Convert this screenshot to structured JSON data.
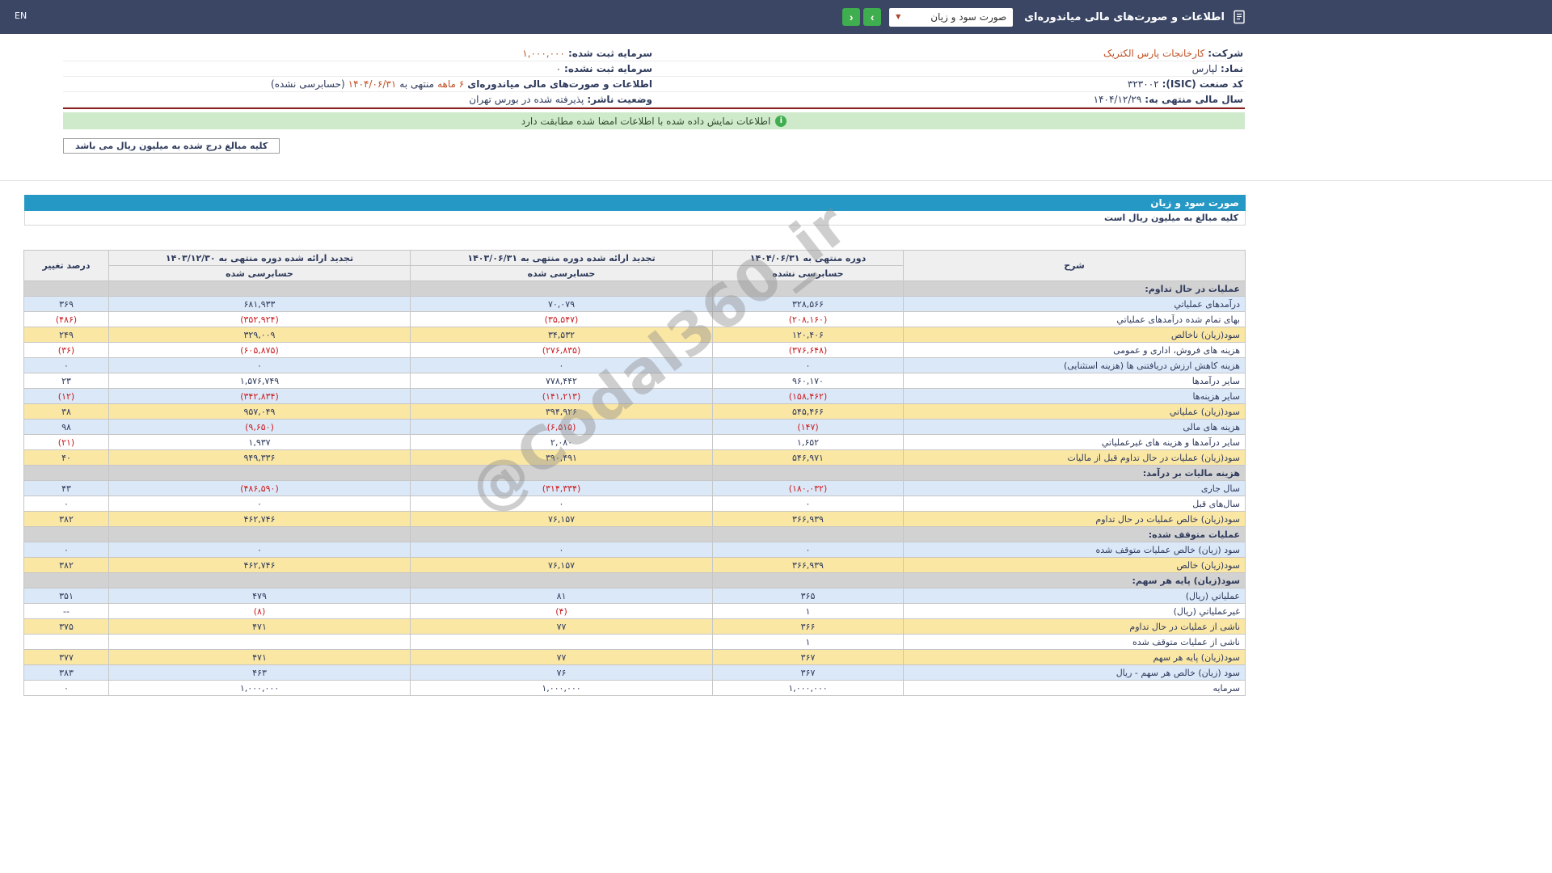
{
  "topbar": {
    "en_label": "EN",
    "title": "اطلاعات و صورت‌های مالی میاندوره‌ای",
    "report_select": {
      "value": "صورت سود و زیان",
      "caret": "▼"
    },
    "nav": {
      "forward": "›",
      "back": "‹"
    }
  },
  "company": {
    "fields": [
      {
        "label": "شرکت:",
        "value": "کارخانجات پارس الکتریک",
        "value_style": "accent"
      },
      {
        "label": "سرمایه ثبت شده:",
        "value": "۱,۰۰۰,۰۰۰",
        "value_style": "accent"
      },
      {
        "label": "نماد:",
        "value": "لپارس"
      },
      {
        "label": "سرمایه ثبت نشده:",
        "value": "۰"
      },
      {
        "label": "کد صنعت (ISIC):",
        "value": "۳۲۳۰۰۲"
      },
      {
        "label": "اطلاعات و صورت‌های مالی میاندوره‌ای",
        "value_parts": [
          {
            "text": "۶ ماهه",
            "accent": true
          },
          {
            "text": " منتهی به ",
            "accent": false
          },
          {
            "text": "۱۴۰۴/۰۶/۳۱",
            "accent": true
          },
          {
            "text": "(حسابرسی نشده)",
            "accent": false
          }
        ]
      },
      {
        "label": "سال مالی منتهی به:",
        "value": "۱۴۰۴/۱۲/۲۹"
      },
      {
        "label": "وضعیت ناشر:",
        "value": "پذیرفته شده در بورس تهران"
      }
    ],
    "signature_notice": "اطلاعات نمایش داده شده با اطلاعات امضا شده مطابقت دارد",
    "info_icon_glyph": "i",
    "unit_note": "کلیه مبالغ درج شده به میلیون ریال می باشد"
  },
  "statement": {
    "title": "صورت سود و زیان",
    "unit_note": "کلیه مبالغ به میلیون ریال است",
    "table": {
      "desc_header": "شرح",
      "pct_header": "درصد تغییر",
      "period_headers": [
        {
          "title": "دوره منتهی به ۱۴۰۴/۰۶/۳۱",
          "sub": "حسابرسی نشده"
        },
        {
          "title": "تجدید ارائه شده دوره منتهی به ۱۴۰۳/۰۶/۳۱",
          "sub": "حسابرسی شده"
        },
        {
          "title": "تجدید ارائه شده دوره منتهی به ۱۴۰۳/۱۲/۳۰",
          "sub": "حسابرسی شده"
        }
      ],
      "rows": [
        {
          "type": "section",
          "label": "عملیات در حال تداوم:"
        },
        {
          "type": "data",
          "bg": "blue",
          "label": "درآمدهای عملیاتي",
          "values": [
            "۳۲۸,۵۶۶",
            "۷۰,۰۷۹",
            "۶۸۱,۹۳۳"
          ],
          "pct": "۳۶۹"
        },
        {
          "type": "data",
          "bg": "white",
          "label": "بهای تمام شده درآمدهای عملیاتي",
          "values": [
            "(۲۰۸,۱۶۰)",
            "(۳۵,۵۴۷)",
            "(۳۵۲,۹۲۴)"
          ],
          "pct": "(۴۸۶)"
        },
        {
          "type": "data",
          "bg": "yellow",
          "label": "سود(زیان) ناخالص",
          "values": [
            "۱۲۰,۴۰۶",
            "۳۴,۵۳۲",
            "۳۲۹,۰۰۹"
          ],
          "pct": "۲۴۹"
        },
        {
          "type": "data",
          "bg": "white",
          "label": "هزینه های فروش، اداری و عمومی",
          "values": [
            "(۳۷۶,۶۴۸)",
            "(۲۷۶,۸۳۵)",
            "(۶۰۵,۸۷۵)"
          ],
          "pct": "(۳۶)"
        },
        {
          "type": "data",
          "bg": "blue",
          "label": "هزینه کاهش ارزش دریافتنی ها (هزینه استثنایی)",
          "values": [
            "۰",
            "۰",
            "۰"
          ],
          "pct": "۰"
        },
        {
          "type": "data",
          "bg": "white",
          "label": "سایر درآمدها",
          "values": [
            "۹۶۰,۱۷۰",
            "۷۷۸,۴۴۲",
            "۱,۵۷۶,۷۴۹"
          ],
          "pct": "۲۳"
        },
        {
          "type": "data",
          "bg": "blue",
          "label": "سایر هزینه‌ها",
          "values": [
            "(۱۵۸,۴۶۲)",
            "(۱۴۱,۲۱۳)",
            "(۳۴۲,۸۳۴)"
          ],
          "pct": "(۱۲)"
        },
        {
          "type": "data",
          "bg": "yellow",
          "label": "سود(زیان) عملیاتي",
          "values": [
            "۵۴۵,۴۶۶",
            "۳۹۴,۹۲۶",
            "۹۵۷,۰۴۹"
          ],
          "pct": "۳۸"
        },
        {
          "type": "data",
          "bg": "blue",
          "label": "هزینه های مالی",
          "values": [
            "(۱۴۷)",
            "(۶,۵۱۵)",
            "(۹,۶۵۰)"
          ],
          "pct": "۹۸"
        },
        {
          "type": "data",
          "bg": "white",
          "label": "سایر درآمدها و هزینه های غیرعملیاتي",
          "values": [
            "۱,۶۵۲",
            "۲,۰۸۰",
            "۱,۹۳۷"
          ],
          "pct": "(۲۱)"
        },
        {
          "type": "data",
          "bg": "yellow",
          "label": "سود(زیان) عملیات در حال تداوم قبل از مالیات",
          "values": [
            "۵۴۶,۹۷۱",
            "۳۹۰,۴۹۱",
            "۹۴۹,۳۳۶"
          ],
          "pct": "۴۰"
        },
        {
          "type": "section",
          "label": "هزینه مالیات بر درآمد:"
        },
        {
          "type": "data",
          "bg": "blue",
          "label": "سال جاری",
          "values": [
            "(۱۸۰,۰۳۲)",
            "(۳۱۴,۳۳۴)",
            "(۴۸۶,۵۹۰)"
          ],
          "pct": "۴۳"
        },
        {
          "type": "data",
          "bg": "white",
          "label": "سال‌های قبل",
          "values": [
            "۰",
            "۰",
            "۰"
          ],
          "pct": "۰"
        },
        {
          "type": "data",
          "bg": "yellow",
          "label": "سود(زیان) خالص عملیات در حال تداوم",
          "values": [
            "۳۶۶,۹۳۹",
            "۷۶,۱۵۷",
            "۴۶۲,۷۴۶"
          ],
          "pct": "۳۸۲"
        },
        {
          "type": "section",
          "label": "عملیات متوقف شده:"
        },
        {
          "type": "data",
          "bg": "blue",
          "label": "سود (زیان) خالص عملیات متوقف شده",
          "values": [
            "۰",
            "۰",
            "۰"
          ],
          "pct": "۰"
        },
        {
          "type": "data",
          "bg": "yellow",
          "label": "سود(زیان) خالص",
          "values": [
            "۳۶۶,۹۳۹",
            "۷۶,۱۵۷",
            "۴۶۲,۷۴۶"
          ],
          "pct": "۳۸۲"
        },
        {
          "type": "section",
          "label": "سود(زیان) پایه هر سهم:"
        },
        {
          "type": "data",
          "bg": "blue",
          "label": "عملیاتي (ریال)",
          "values": [
            "۳۶۵",
            "۸۱",
            "۴۷۹"
          ],
          "pct": "۳۵۱"
        },
        {
          "type": "data",
          "bg": "white",
          "label": "غیرعملیاتي (ریال)",
          "values": [
            "۱",
            "(۴)",
            "(۸)"
          ],
          "pct": "--"
        },
        {
          "type": "data",
          "bg": "yellow",
          "label": "ناشی از عملیات در حال تداوم",
          "values": [
            "۳۶۶",
            "۷۷",
            "۴۷۱"
          ],
          "pct": "۳۷۵"
        },
        {
          "type": "data",
          "bg": "white",
          "label": "ناشی از عملیات متوقف شده",
          "values": [
            "۱",
            "",
            ""
          ],
          "pct": ""
        },
        {
          "type": "data",
          "bg": "yellow",
          "label": "سود(زیان) پایه هر سهم",
          "values": [
            "۳۶۷",
            "۷۷",
            "۴۷۱"
          ],
          "pct": "۳۷۷"
        },
        {
          "type": "data",
          "bg": "blue",
          "label": "سود (زیان) خالص هر سهم - ریال",
          "values": [
            "۳۶۷",
            "۷۶",
            "۴۶۳"
          ],
          "pct": "۳۸۳"
        },
        {
          "type": "data",
          "bg": "white",
          "label": "سرمایه",
          "values": [
            "۱,۰۰۰,۰۰۰",
            "۱,۰۰۰,۰۰۰",
            "۱,۰۰۰,۰۰۰"
          ],
          "pct": "۰"
        }
      ]
    }
  },
  "watermark": "@Codal360_ir",
  "palette": {
    "topbar_bg": "#3a4664",
    "statement_title_bg": "#2598c5",
    "row_highlight": "#fbe7a4",
    "row_stripe": "#dbe8f8",
    "row_section": "#d2d2d2",
    "negative_text": "#cb1d20",
    "accent_text": "#bf5226",
    "button_green": "#3fae4f",
    "banner_green": "#cfe9cb",
    "separator_red": "#8b1d1d"
  }
}
